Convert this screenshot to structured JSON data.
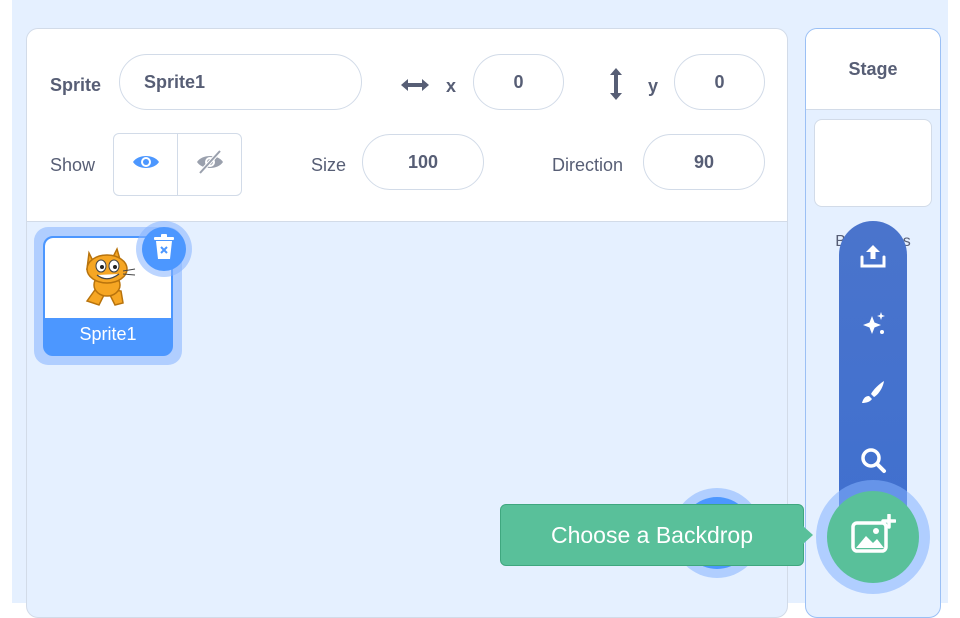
{
  "sprite_info": {
    "sprite_label": "Sprite",
    "sprite_name": "Sprite1",
    "x_label": "x",
    "x_value": "0",
    "y_label": "y",
    "y_value": "0",
    "show_label": "Show",
    "size_label": "Size",
    "size_value": "100",
    "direction_label": "Direction",
    "direction_value": "90"
  },
  "sprites": [
    {
      "name": "Sprite1",
      "selected": true
    }
  ],
  "stage": {
    "title": "Stage",
    "backdrops_label": "Backdrops"
  },
  "backdrop_menu": {
    "items": [
      "upload-icon",
      "surprise-icon",
      "paint-icon",
      "search-icon"
    ],
    "tooltip": "Choose a Backdrop"
  },
  "colors": {
    "primary": "#4c97ff",
    "menu": "#4070cf",
    "green": "#59c09a",
    "text": "#575e75",
    "background": "#e5f0ff"
  }
}
